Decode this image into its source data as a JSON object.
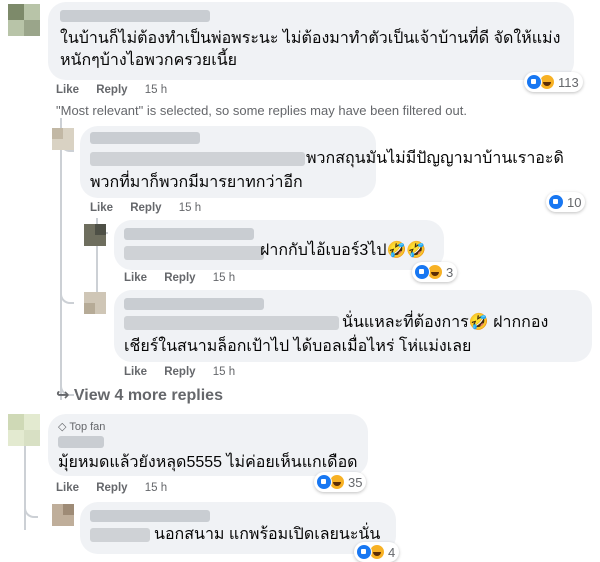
{
  "actions": {
    "like": "Like",
    "reply": "Reply"
  },
  "filter_note": "\"Most relevant\" is selected, so some replies may have been filtered out.",
  "comments": [
    {
      "lines": [
        "ในบ้านก็ไม่ต้องทำเป็นพ่อพระนะ ไม่ต้องมาทำตัวเป็นเจ้าบ้านที่ดี จัดให้แม่ง",
        "หนักๆบ้างไอพวกครวยเนี้ย"
      ],
      "time": "15 h",
      "reaction_count": "113"
    },
    {
      "lines": [
        "พวกสถุนมันไม่มีปัญญามาบ้านเราอะดิ",
        "พวกที่มาก็พวกมีมารยาทกว่าอีก"
      ],
      "time": "15 h",
      "reaction_count": "10"
    },
    {
      "lines": [
        "ฝากกับไอ้เบอร์3ไป🤣🤣"
      ],
      "time": "15 h",
      "reaction_count": "3"
    },
    {
      "lines": [
        "นั่นแหละที่ต้องการ🤣 ฝากกอง",
        "เชียร์ในสนามล็อกเป้าไป ได้บอลเมื่อไหร่ โห่แม่งเลย"
      ],
      "time": "15 h",
      "reaction_count": ""
    },
    {
      "badge": "Top fan",
      "lines": [
        "มุ้ยหมดแล้วยังหลุด5555 ไม่ค่อยเห็นแกเดือด"
      ],
      "time": "15 h",
      "reaction_count": "35"
    },
    {
      "lines": [
        "นอกสนาม แกพร้อมเปิดเลยนะนั่น"
      ],
      "time": "",
      "reaction_count": "4"
    }
  ],
  "view_more": "View 4 more replies",
  "colors": {
    "bubble": "#f0f2f5",
    "meta": "#65676b",
    "like": "#1877f2",
    "haha": "#f7b125"
  }
}
